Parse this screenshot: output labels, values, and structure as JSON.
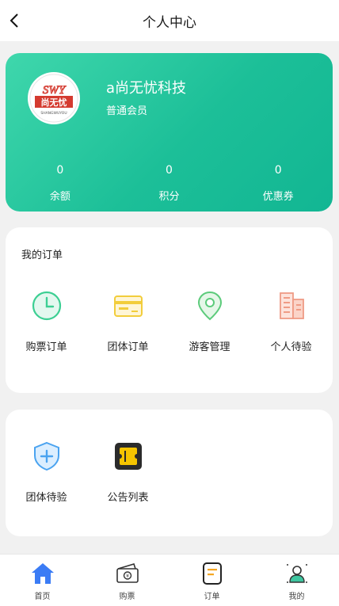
{
  "header": {
    "title": "个人中心"
  },
  "profile": {
    "logo_text": "SWY",
    "logo_cn": "尚无忧",
    "logo_sub": "SHANGWUYOU",
    "company_name": "a尚无忧科技",
    "member_level": "普通会员",
    "stats": [
      {
        "value": "0",
        "label": "余额"
      },
      {
        "value": "0",
        "label": "积分"
      },
      {
        "value": "0",
        "label": "优惠券"
      }
    ]
  },
  "orders": {
    "title": "我的订单",
    "items": [
      {
        "label": "购票订单",
        "icon": "clock-icon"
      },
      {
        "label": "团体订单",
        "icon": "card-icon"
      },
      {
        "label": "游客管理",
        "icon": "location-pin-icon"
      },
      {
        "label": "个人待验",
        "icon": "building-icon"
      }
    ]
  },
  "tools": {
    "items": [
      {
        "label": "团体待验",
        "icon": "shield-plus-icon"
      },
      {
        "label": "公告列表",
        "icon": "ticket-icon"
      }
    ]
  },
  "nav": {
    "items": [
      {
        "label": "首页",
        "icon": "home-icon",
        "active": true
      },
      {
        "label": "购票",
        "icon": "wallet-icon"
      },
      {
        "label": "订单",
        "icon": "order-icon"
      },
      {
        "label": "我的",
        "icon": "user-icon"
      }
    ]
  },
  "colors": {
    "accent": "#1cbf98",
    "nav_active": "#3b7cf5",
    "background": "#f1f1f1"
  }
}
